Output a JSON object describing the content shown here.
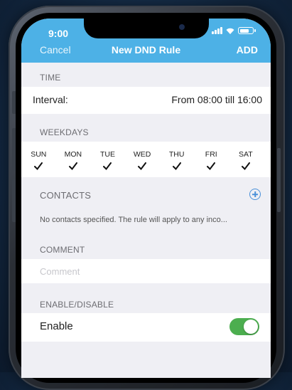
{
  "status": {
    "time": "9:00"
  },
  "nav": {
    "cancel": "Cancel",
    "title": "New DND Rule",
    "add": "ADD"
  },
  "time_section": {
    "header": "TIME",
    "interval_label": "Interval:",
    "interval_value": "From 08:00 till 16:00"
  },
  "weekdays": {
    "header": "WEEKDAYS",
    "days": [
      {
        "label": "SUN",
        "checked": true
      },
      {
        "label": "MON",
        "checked": true
      },
      {
        "label": "TUE",
        "checked": true
      },
      {
        "label": "WED",
        "checked": true
      },
      {
        "label": "THU",
        "checked": true
      },
      {
        "label": "FRI",
        "checked": true
      },
      {
        "label": "SAT",
        "checked": true
      }
    ]
  },
  "contacts": {
    "header": "CONTACTS",
    "note": "No contacts specified. The rule will apply to any inco..."
  },
  "comment": {
    "header": "COMMENT",
    "placeholder": "Comment",
    "value": ""
  },
  "enable": {
    "header": "ENABLE/DISABLE",
    "label": "Enable",
    "on": true
  },
  "colors": {
    "nav_bg": "#4db1e6",
    "toggle_on": "#4cae4f",
    "accent": "#4a90d9"
  }
}
